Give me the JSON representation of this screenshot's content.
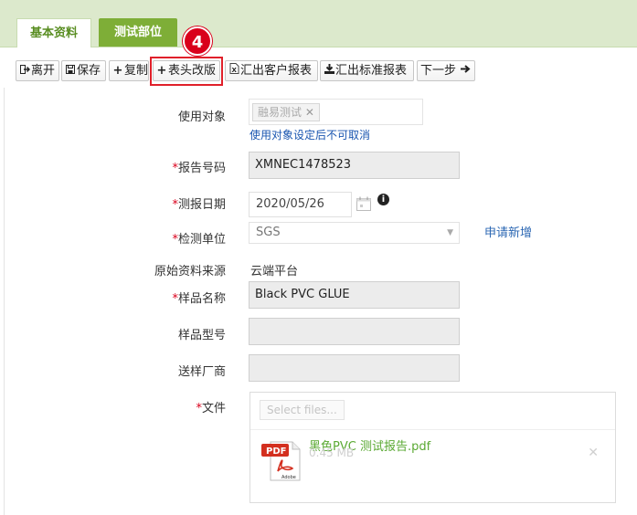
{
  "tabs": [
    {
      "label": "基本资料",
      "active": true
    },
    {
      "label": "测试部位",
      "active": false
    }
  ],
  "step_badge": "4",
  "toolbar": {
    "leave": "离开",
    "save": "保存",
    "copy": "复制",
    "header_edit": "表头改版",
    "export_customer": "汇出客户报表",
    "export_standard": "汇出标准报表",
    "next_step": "下一步"
  },
  "form": {
    "use_target": {
      "label": "使用对象",
      "tag": "融易测试",
      "hint": "使用对象设定后不可取消"
    },
    "report_no": {
      "label": "报告号码",
      "value": "XMNEC1478523"
    },
    "report_date": {
      "label": "测报日期",
      "value": "2020/05/26"
    },
    "test_unit": {
      "label": "检测单位",
      "value": "SGS",
      "apply_link": "申请新增"
    },
    "data_source": {
      "label": "原始资料来源",
      "value": "云端平台"
    },
    "sample_name": {
      "label": "样品名称",
      "value": "Black PVC GLUE"
    },
    "sample_model": {
      "label": "样品型号",
      "value": ""
    },
    "supplier": {
      "label": "送样厂商",
      "value": ""
    },
    "file": {
      "label": "文件",
      "select_placeholder": "Select files...",
      "file_name": "黑色PVC 测试报告.pdf",
      "file_size": "0.45 MB",
      "pdf_badge": "PDF",
      "pdf_brand": "Adobe"
    }
  },
  "required_mark": "*",
  "colors": {
    "tab_band": "#dce9cc",
    "tab_active_text": "#5a8e23",
    "tab_inactive_bg": "#7eae37",
    "badge": "#d9001b",
    "required": "#d9001b",
    "link": "#2b67b3",
    "file_name": "#5aa933"
  }
}
